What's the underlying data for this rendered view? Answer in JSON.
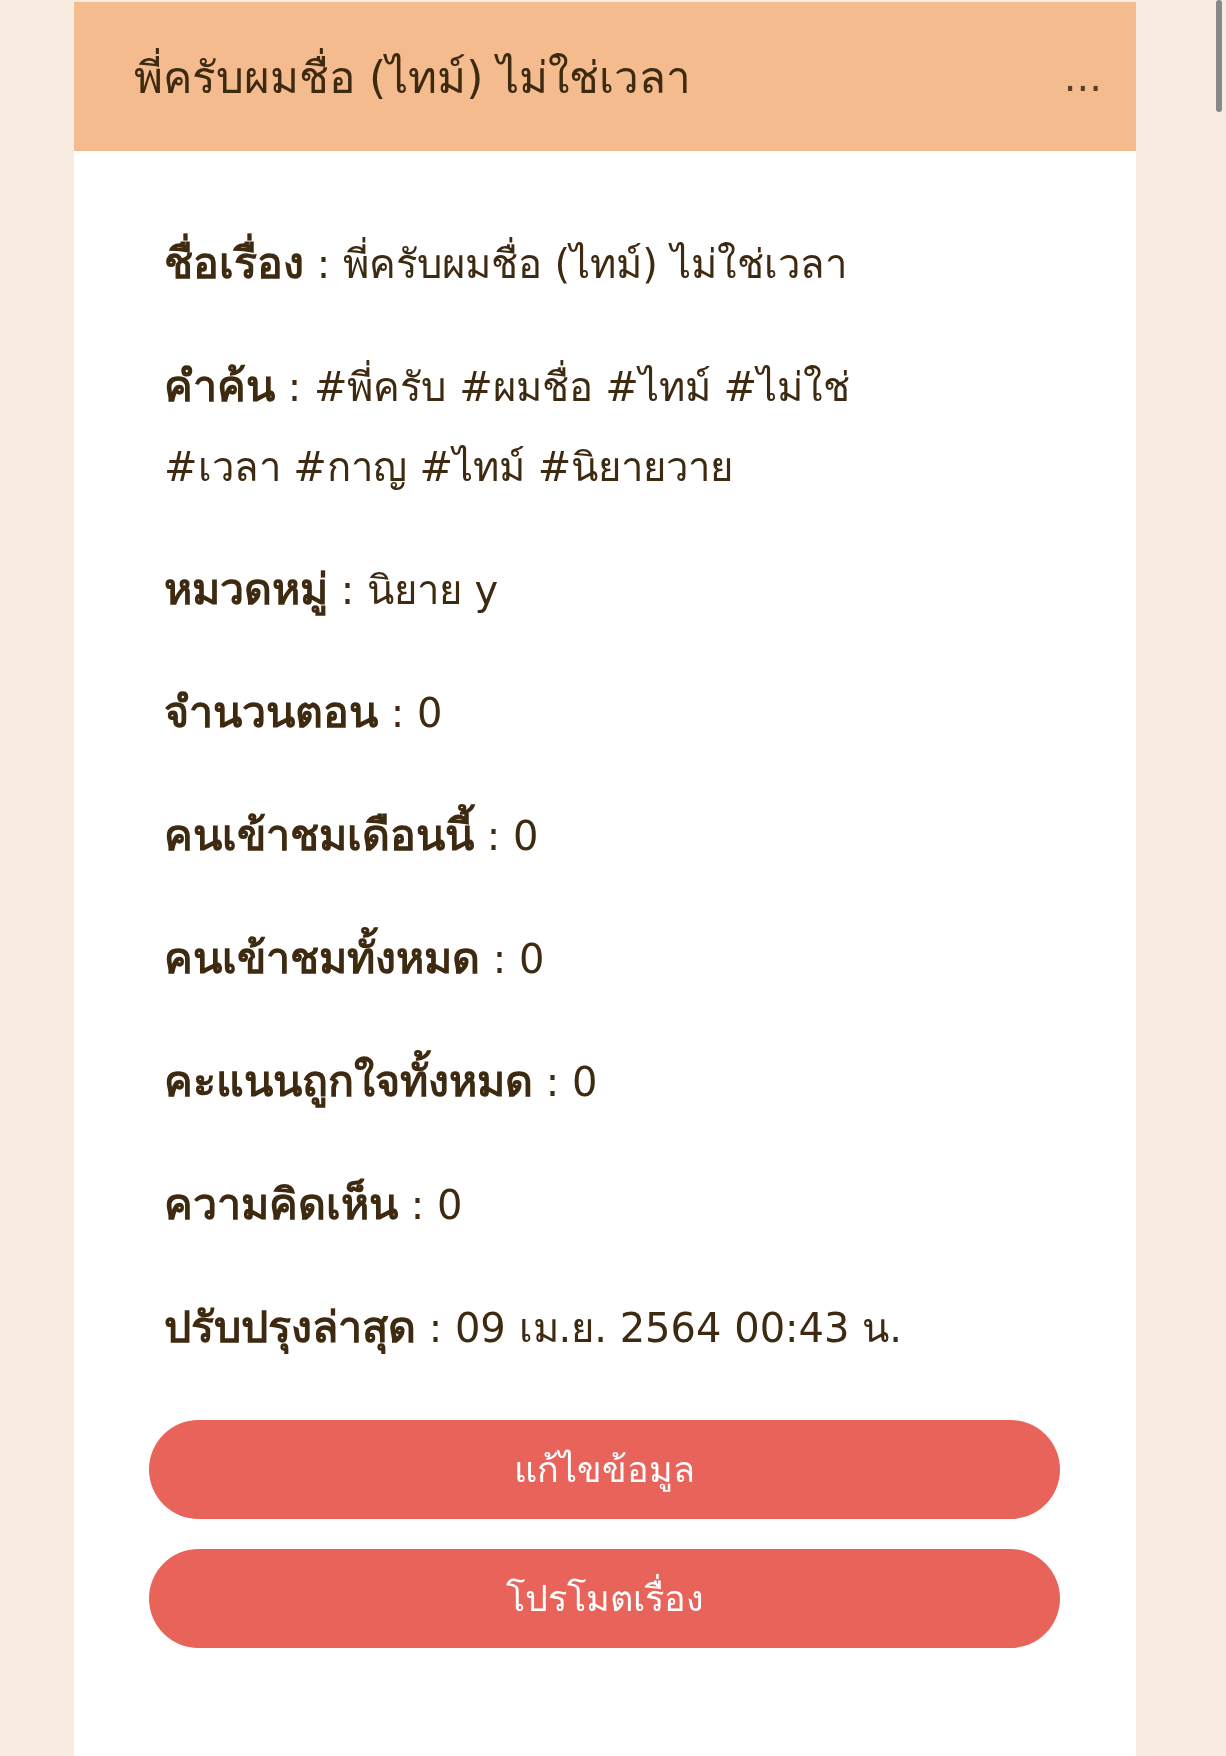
{
  "header": {
    "title": "พี่ครับผมชื่อ (ไทม์) ไม่ใช่เวลา",
    "menu": "..."
  },
  "details": [
    "**ชื่อเรื่อง** : พี่ครับผมชื่อ (ไทม์) ไม่ใช่เวลา",
    "**คำค้น** : #พี่ครับ #ผมชื่อ #ไทม์ #ไม่ใช่ #เวลา #กาญ #ไทม์ #นิยายวาย",
    "**หมวดหมู่** : นิยาย y",
    "**จำนวนตอน** : 0",
    "**คนเข้าชมเดือนนี้** : 0",
    "**คนเข้าชมทั้งหมด** : 0",
    "**คะแนนถูกใจทั้งหมด** : 0",
    "**ความคิดเห็น** : 0",
    "**ปรับปรุงล่าสุด** : 09 เม.ย. 2564 00:43 น."
  ],
  "buttons": [
    "แก้ไขข้อมูล",
    "โปรโมตเรื่อง"
  ]
}
